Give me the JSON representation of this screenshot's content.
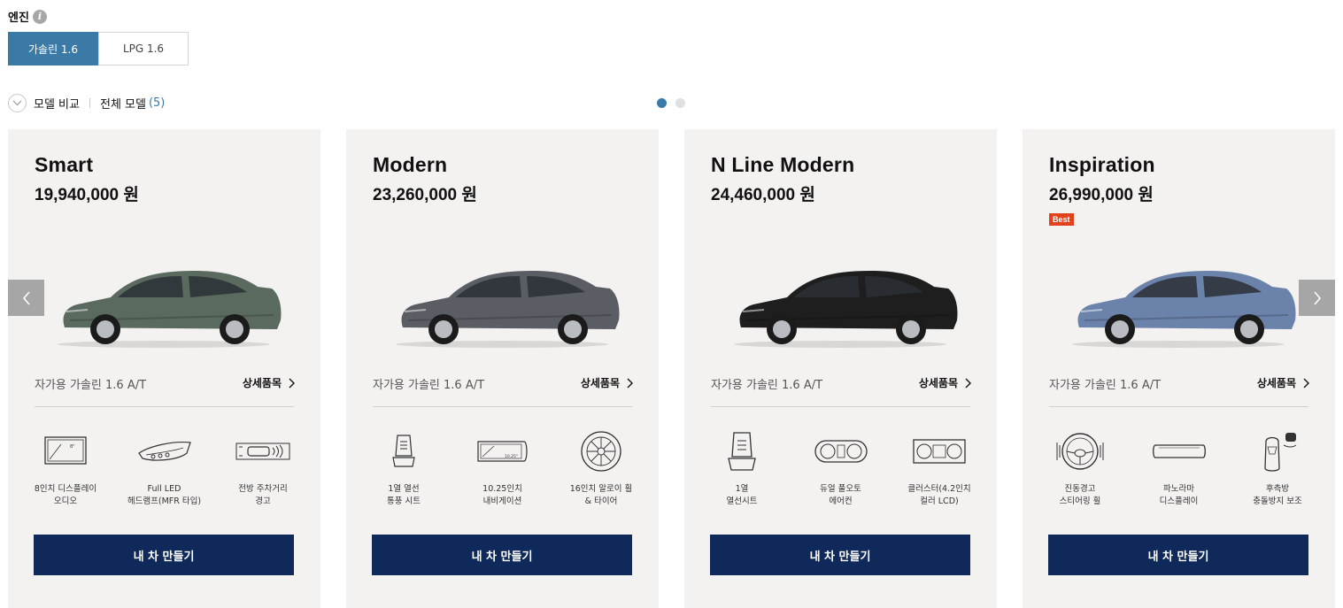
{
  "engine": {
    "title": "엔진",
    "info_icon": "info-icon",
    "tabs": [
      {
        "label": "가솔린 1.6",
        "active": true
      },
      {
        "label": "LPG 1.6",
        "active": false
      }
    ]
  },
  "toolbar": {
    "compare_label": "모델 비교",
    "all_models_label": "전체 모델",
    "all_models_count": "(5)"
  },
  "carousel": {
    "pages": 2,
    "active_page": 1
  },
  "colors": {
    "accent": "#3b7aa6",
    "button": "#0f2a5a",
    "card_bg": "#f3f2f1",
    "best_badge": "#e2411c"
  },
  "cards": [
    {
      "name": "Smart",
      "price": "19,940,000 원",
      "badge": "",
      "car_color": "#5b6a5e",
      "trim": "자가용 가솔린 1.6 A/T",
      "detail_link": "상세품목",
      "features": [
        {
          "icon": "display-audio-icon",
          "label": "8인치 디스플레이\n오디오"
        },
        {
          "icon": "led-headlamp-icon",
          "label": "Full LED\n헤드램프(MFR 타입)"
        },
        {
          "icon": "front-parking-sensor-icon",
          "label": "전방 주차거리\n경고"
        }
      ],
      "button": "내 차 만들기"
    },
    {
      "name": "Modern",
      "price": "23,260,000 원",
      "badge": "",
      "car_color": "#5a5d63",
      "trim": "자가용 가솔린 1.6 A/T",
      "detail_link": "상세품목",
      "features": [
        {
          "icon": "heated-seat-icon",
          "label": "1열 열선\n통풍 시트"
        },
        {
          "icon": "navigation-display-icon",
          "label": "10.25인치\n내비게이션"
        },
        {
          "icon": "alloy-wheel-icon",
          "label": "16인치 알로이 휠\n& 타이어"
        }
      ],
      "button": "내 차 만들기"
    },
    {
      "name": "N Line Modern",
      "price": "24,460,000 원",
      "badge": "",
      "car_color": "#1e1e1f",
      "trim": "자가용 가솔린 1.6 A/T",
      "detail_link": "상세품목",
      "features": [
        {
          "icon": "heated-seat-icon",
          "label": "1열\n열선시트"
        },
        {
          "icon": "dual-climate-icon",
          "label": "듀얼 풀오토\n에어컨"
        },
        {
          "icon": "cluster-icon",
          "label": "클러스터(4.2인치\n컬러 LCD)"
        }
      ],
      "button": "내 차 만들기"
    },
    {
      "name": "Inspiration",
      "price": "26,990,000 원",
      "badge": "Best",
      "car_color": "#6b82aa",
      "trim": "자가용 가솔린 1.6 A/T",
      "detail_link": "상세품목",
      "features": [
        {
          "icon": "vibrating-steering-wheel-icon",
          "label": "진동경고\n스티어링 휠"
        },
        {
          "icon": "panorama-display-icon",
          "label": "파노라마\n디스플레이"
        },
        {
          "icon": "rear-collision-assist-icon",
          "label": "후측방\n충돌방지 보조"
        }
      ],
      "button": "내 차 만들기"
    }
  ]
}
